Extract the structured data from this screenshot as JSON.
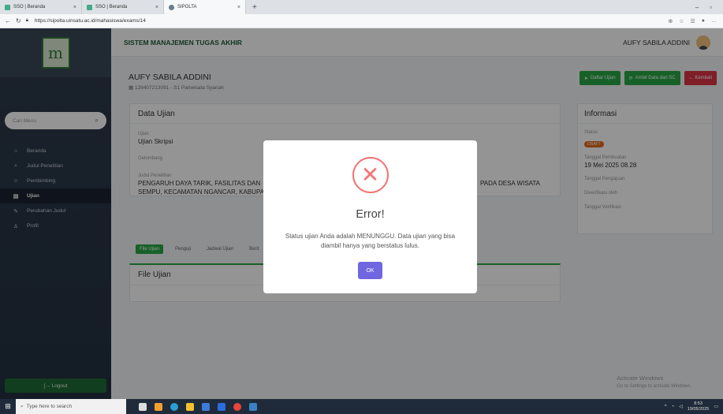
{
  "browser": {
    "tabs": [
      {
        "title": "SSO | Beranda"
      },
      {
        "title": "SSO | Beranda"
      },
      {
        "title": "SIPOLTA"
      }
    ],
    "new_tab": "+",
    "url": "https://sipolta.uinsatu.ac.id/mahasiswa/exams/14"
  },
  "app": {
    "title": "SISTEM MANAJEMEN TUGAS AKHIR",
    "user": "AUFY SABILA ADDINI"
  },
  "sidebar": {
    "search_placeholder": "Cari Menu",
    "items": [
      {
        "label": "Beranda",
        "icon": "home-icon",
        "glyph": "⌂"
      },
      {
        "label": "Judul Penelitian",
        "icon": "search-icon",
        "glyph": "⌕"
      },
      {
        "label": "Pembimbing",
        "icon": "group-icon",
        "glyph": "☺"
      },
      {
        "label": "Ujian",
        "icon": "document-icon",
        "glyph": "▤"
      },
      {
        "label": "Perubahan Judul",
        "icon": "edit-icon",
        "glyph": "✎"
      },
      {
        "label": "Profil",
        "icon": "user-icon",
        "glyph": "♙"
      }
    ],
    "logout": "[→ Logout"
  },
  "student": {
    "name": "AUFY SABILA ADDINI",
    "id_line": "126407213091 - S1 Pariwisata Syariah"
  },
  "actions": {
    "list": "Daftar Ujian",
    "fetch": "Ambil Data dari SC",
    "back": "← Kembali"
  },
  "exam_data": {
    "heading": "Data Ujian",
    "exam_label": "Ujian",
    "exam_value": "Ujian Skripsi",
    "wave_label": "Gelombang",
    "title_label": "Judul Penelitian",
    "title_line1": "PENGARUH DAYA TARIK, FASILITAS DAN",
    "title_line1_end": "PADA DESA WISATA",
    "title_line2": "SEMPU, KECAMATAN NGANCAR, KABUPA"
  },
  "info": {
    "heading": "Informasi",
    "status_label": "Status",
    "status_value": "DRAFT",
    "created_label": "Tanggal Pembuatan",
    "created_value": "19 Mei 2025 08.28",
    "submitted_label": "Tanggal Pengajuan",
    "verified_by_label": "Diverifikasi oleh",
    "verified_date_label": "Tanggal Verifikasi"
  },
  "tabs": [
    "File Ujian",
    "Penguji",
    "Jadwal Ujian",
    "Berit"
  ],
  "file_section": {
    "heading": "File Ujian"
  },
  "modal": {
    "title": "Error!",
    "message": "Status ujian Anda adalah MENUNGGU. Data ujian yang bisa diambil hanya yang berstatus lulus.",
    "ok": "OK"
  },
  "watermark": {
    "line1": "Activate Windows",
    "line2": "Go to Settings to activate Windows."
  },
  "taskbar": {
    "search_placeholder": "Type here to search",
    "time": "8:53",
    "date": "19/05/2025"
  },
  "colors": {
    "brand_green": "#28a745",
    "danger_red": "#dc3545",
    "error_icon": "#f27474",
    "ok_button": "#7066e0",
    "draft_badge": "#e66a1d"
  }
}
